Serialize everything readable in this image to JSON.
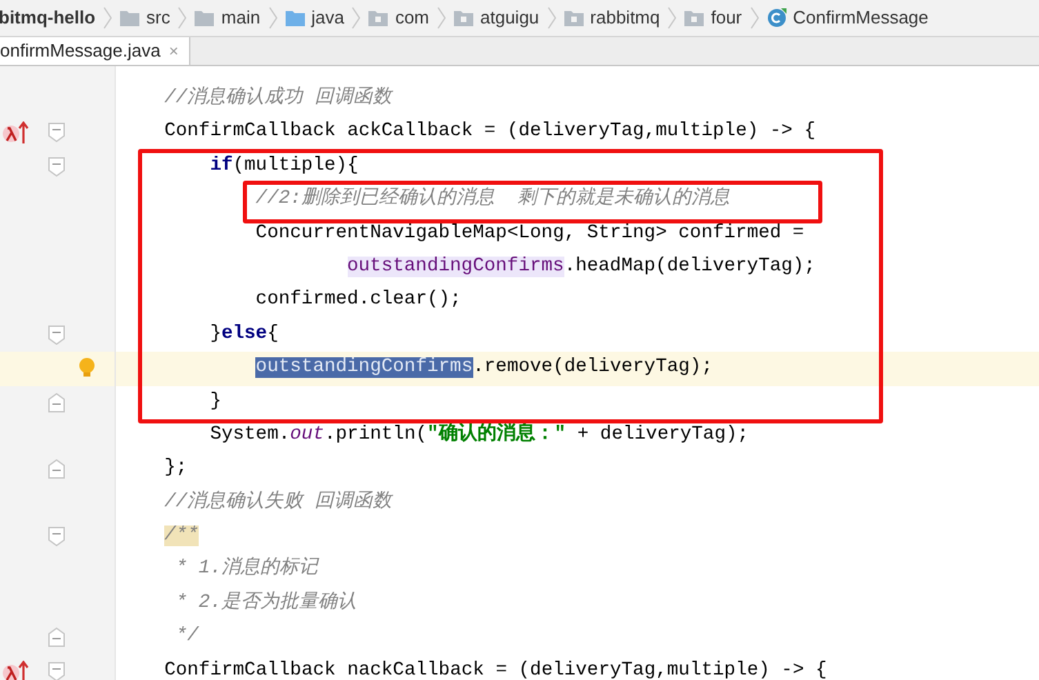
{
  "breadcrumbs": [
    {
      "kind": "project",
      "label": "bitmq-hello"
    },
    {
      "kind": "folder",
      "label": "src"
    },
    {
      "kind": "folder",
      "label": "main"
    },
    {
      "kind": "source",
      "label": "java"
    },
    {
      "kind": "package",
      "label": "com"
    },
    {
      "kind": "package",
      "label": "atguigu"
    },
    {
      "kind": "package",
      "label": "rabbitmq"
    },
    {
      "kind": "package",
      "label": "four"
    },
    {
      "kind": "class",
      "label": "ConfirmMessage"
    }
  ],
  "tabs": [
    {
      "label": "onfirmMessage.java",
      "close": "×",
      "selected": true
    }
  ],
  "lines": [
    {
      "fold_start": false,
      "fold_end": false,
      "lambda": false,
      "bulb": false,
      "current": false,
      "tokens": [
        {
          "kind": "comment",
          "text": "//消息确认成功 回调函数"
        }
      ]
    },
    {
      "fold_start": true,
      "fold_end": false,
      "lambda": true,
      "bulb": false,
      "current": false,
      "tokens": [
        {
          "kind": "plain",
          "text": "ConfirmCallback ackCallback = (deliveryTag,multiple) -> {"
        }
      ],
      "children": [
        {
          "fold_start": true,
          "fold_end": false,
          "lambda": false,
          "bulb": false,
          "current": false,
          "tokens": [
            {
              "kind": "keyword",
              "text": "if"
            },
            {
              "kind": "plain",
              "text": "(multiple){"
            }
          ],
          "children": [
            {
              "fold_start": false,
              "fold_end": false,
              "lambda": false,
              "bulb": false,
              "current": false,
              "tokens": [
                {
                  "kind": "comment",
                  "text": "//2:删除到已经确认的消息  剩下的就是未确认的消息"
                }
              ]
            },
            {
              "fold_start": false,
              "fold_end": false,
              "lambda": false,
              "bulb": false,
              "current": false,
              "tokens": [
                {
                  "kind": "plain",
                  "text": "ConcurrentNavigableMap<Long, String> confirmed ="
                }
              ],
              "children": [
                {
                  "fold_start": false,
                  "fold_end": false,
                  "lambda": false,
                  "bulb": false,
                  "current": false,
                  "continuation": true,
                  "tokens": [
                    {
                      "kind": "field",
                      "text": "outstandingConfirms"
                    },
                    {
                      "kind": "plain",
                      "text": ".headMap(deliveryTag);"
                    }
                  ]
                }
              ]
            },
            {
              "fold_start": false,
              "fold_end": false,
              "lambda": false,
              "bulb": false,
              "current": false,
              "tokens": [
                {
                  "kind": "plain",
                  "text": "confirmed.clear();"
                }
              ]
            }
          ]
        },
        {
          "fold_start": true,
          "fold_end": false,
          "lambda": false,
          "bulb": false,
          "current": false,
          "tokens": [
            {
              "kind": "plain",
              "text": "}"
            },
            {
              "kind": "keyword",
              "text": "else"
            },
            {
              "kind": "plain",
              "text": "{"
            }
          ],
          "children": [
            {
              "fold_start": false,
              "fold_end": false,
              "lambda": false,
              "bulb": true,
              "current": true,
              "tokens": [
                {
                  "kind": "selection",
                  "text": "outstandingConfirms"
                },
                {
                  "kind": "plain",
                  "text": ".remove(deliveryTag);"
                }
              ]
            }
          ]
        },
        {
          "fold_start": false,
          "fold_end": true,
          "lambda": false,
          "bulb": false,
          "current": false,
          "tokens": [
            {
              "kind": "plain",
              "text": "}"
            }
          ]
        },
        {
          "fold_start": false,
          "fold_end": false,
          "lambda": false,
          "bulb": false,
          "current": false,
          "tokens": [
            {
              "kind": "plain",
              "text": "System."
            },
            {
              "kind": "static",
              "text": "out"
            },
            {
              "kind": "plain",
              "text": ".println("
            },
            {
              "kind": "string",
              "text": "\"确认的消息：\""
            },
            {
              "kind": "plain",
              "text": " + deliveryTag);"
            }
          ]
        }
      ]
    },
    {
      "fold_start": false,
      "fold_end": true,
      "lambda": false,
      "bulb": false,
      "current": false,
      "tokens": [
        {
          "kind": "plain",
          "text": "};"
        }
      ]
    },
    {
      "fold_start": false,
      "fold_end": false,
      "lambda": false,
      "bulb": false,
      "current": false,
      "tokens": [
        {
          "kind": "comment",
          "text": "//消息确认失败 回调函数"
        }
      ]
    },
    {
      "fold_start": true,
      "fold_end": false,
      "lambda": false,
      "bulb": false,
      "current": false,
      "tokens": [
        {
          "kind": "doc_highlight",
          "text": "/**"
        }
      ]
    },
    {
      "fold_start": false,
      "fold_end": false,
      "lambda": false,
      "bulb": false,
      "current": false,
      "tokens": [
        {
          "kind": "comment",
          "text": " * 1.消息的标记"
        }
      ]
    },
    {
      "fold_start": false,
      "fold_end": false,
      "lambda": false,
      "bulb": false,
      "current": false,
      "tokens": [
        {
          "kind": "comment",
          "text": " * 2.是否为批量确认"
        }
      ]
    },
    {
      "fold_start": false,
      "fold_end": true,
      "lambda": false,
      "bulb": false,
      "current": false,
      "tokens": [
        {
          "kind": "comment",
          "text": " */"
        }
      ]
    },
    {
      "fold_start": true,
      "fold_end": false,
      "lambda": true,
      "bulb": false,
      "current": false,
      "tokens": [
        {
          "kind": "plain",
          "text": "ConfirmCallback nackCallback = (deliveryTag,multiple) -> {"
        }
      ]
    }
  ]
}
